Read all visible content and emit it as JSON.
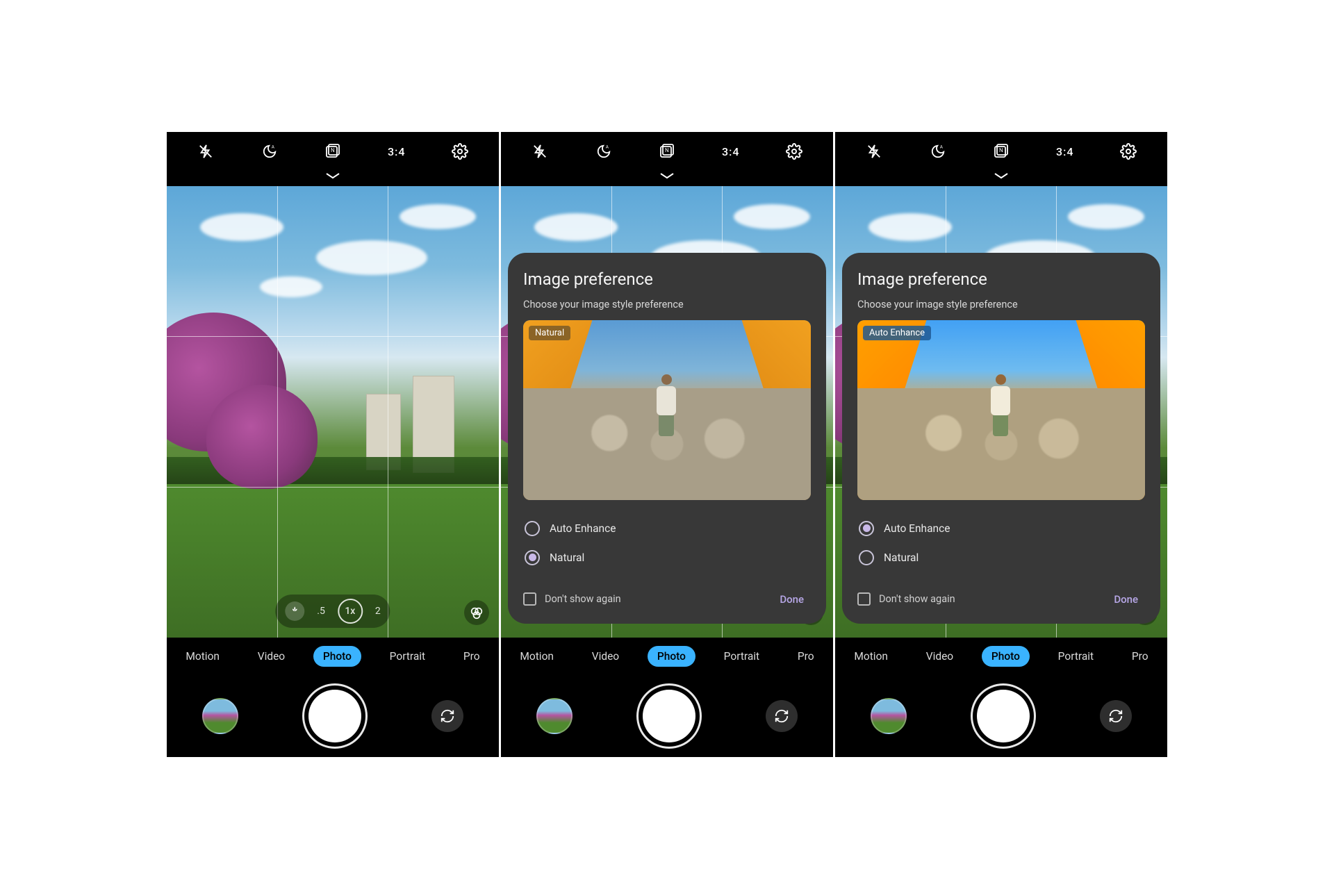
{
  "topbar": {
    "ratio": "3:4"
  },
  "zoom": {
    "levels": [
      ".5",
      "1x",
      "2"
    ],
    "selected": "1x"
  },
  "modes": {
    "items": [
      "Motion",
      "Video",
      "Photo",
      "Portrait",
      "Pro"
    ],
    "selected": "Photo"
  },
  "dialog": {
    "title": "Image preference",
    "subtitle": "Choose your image style preference",
    "badge_natural": "Natural",
    "badge_enhance": "Auto Enhance",
    "option_enhance": "Auto Enhance",
    "option_natural": "Natural",
    "dont_show": "Don't show again",
    "done": "Done"
  },
  "screens": [
    {
      "show_dialog": false
    },
    {
      "show_dialog": true,
      "selected_option": "natural",
      "badge": "natural"
    },
    {
      "show_dialog": true,
      "selected_option": "enhance",
      "badge": "enhance"
    }
  ]
}
